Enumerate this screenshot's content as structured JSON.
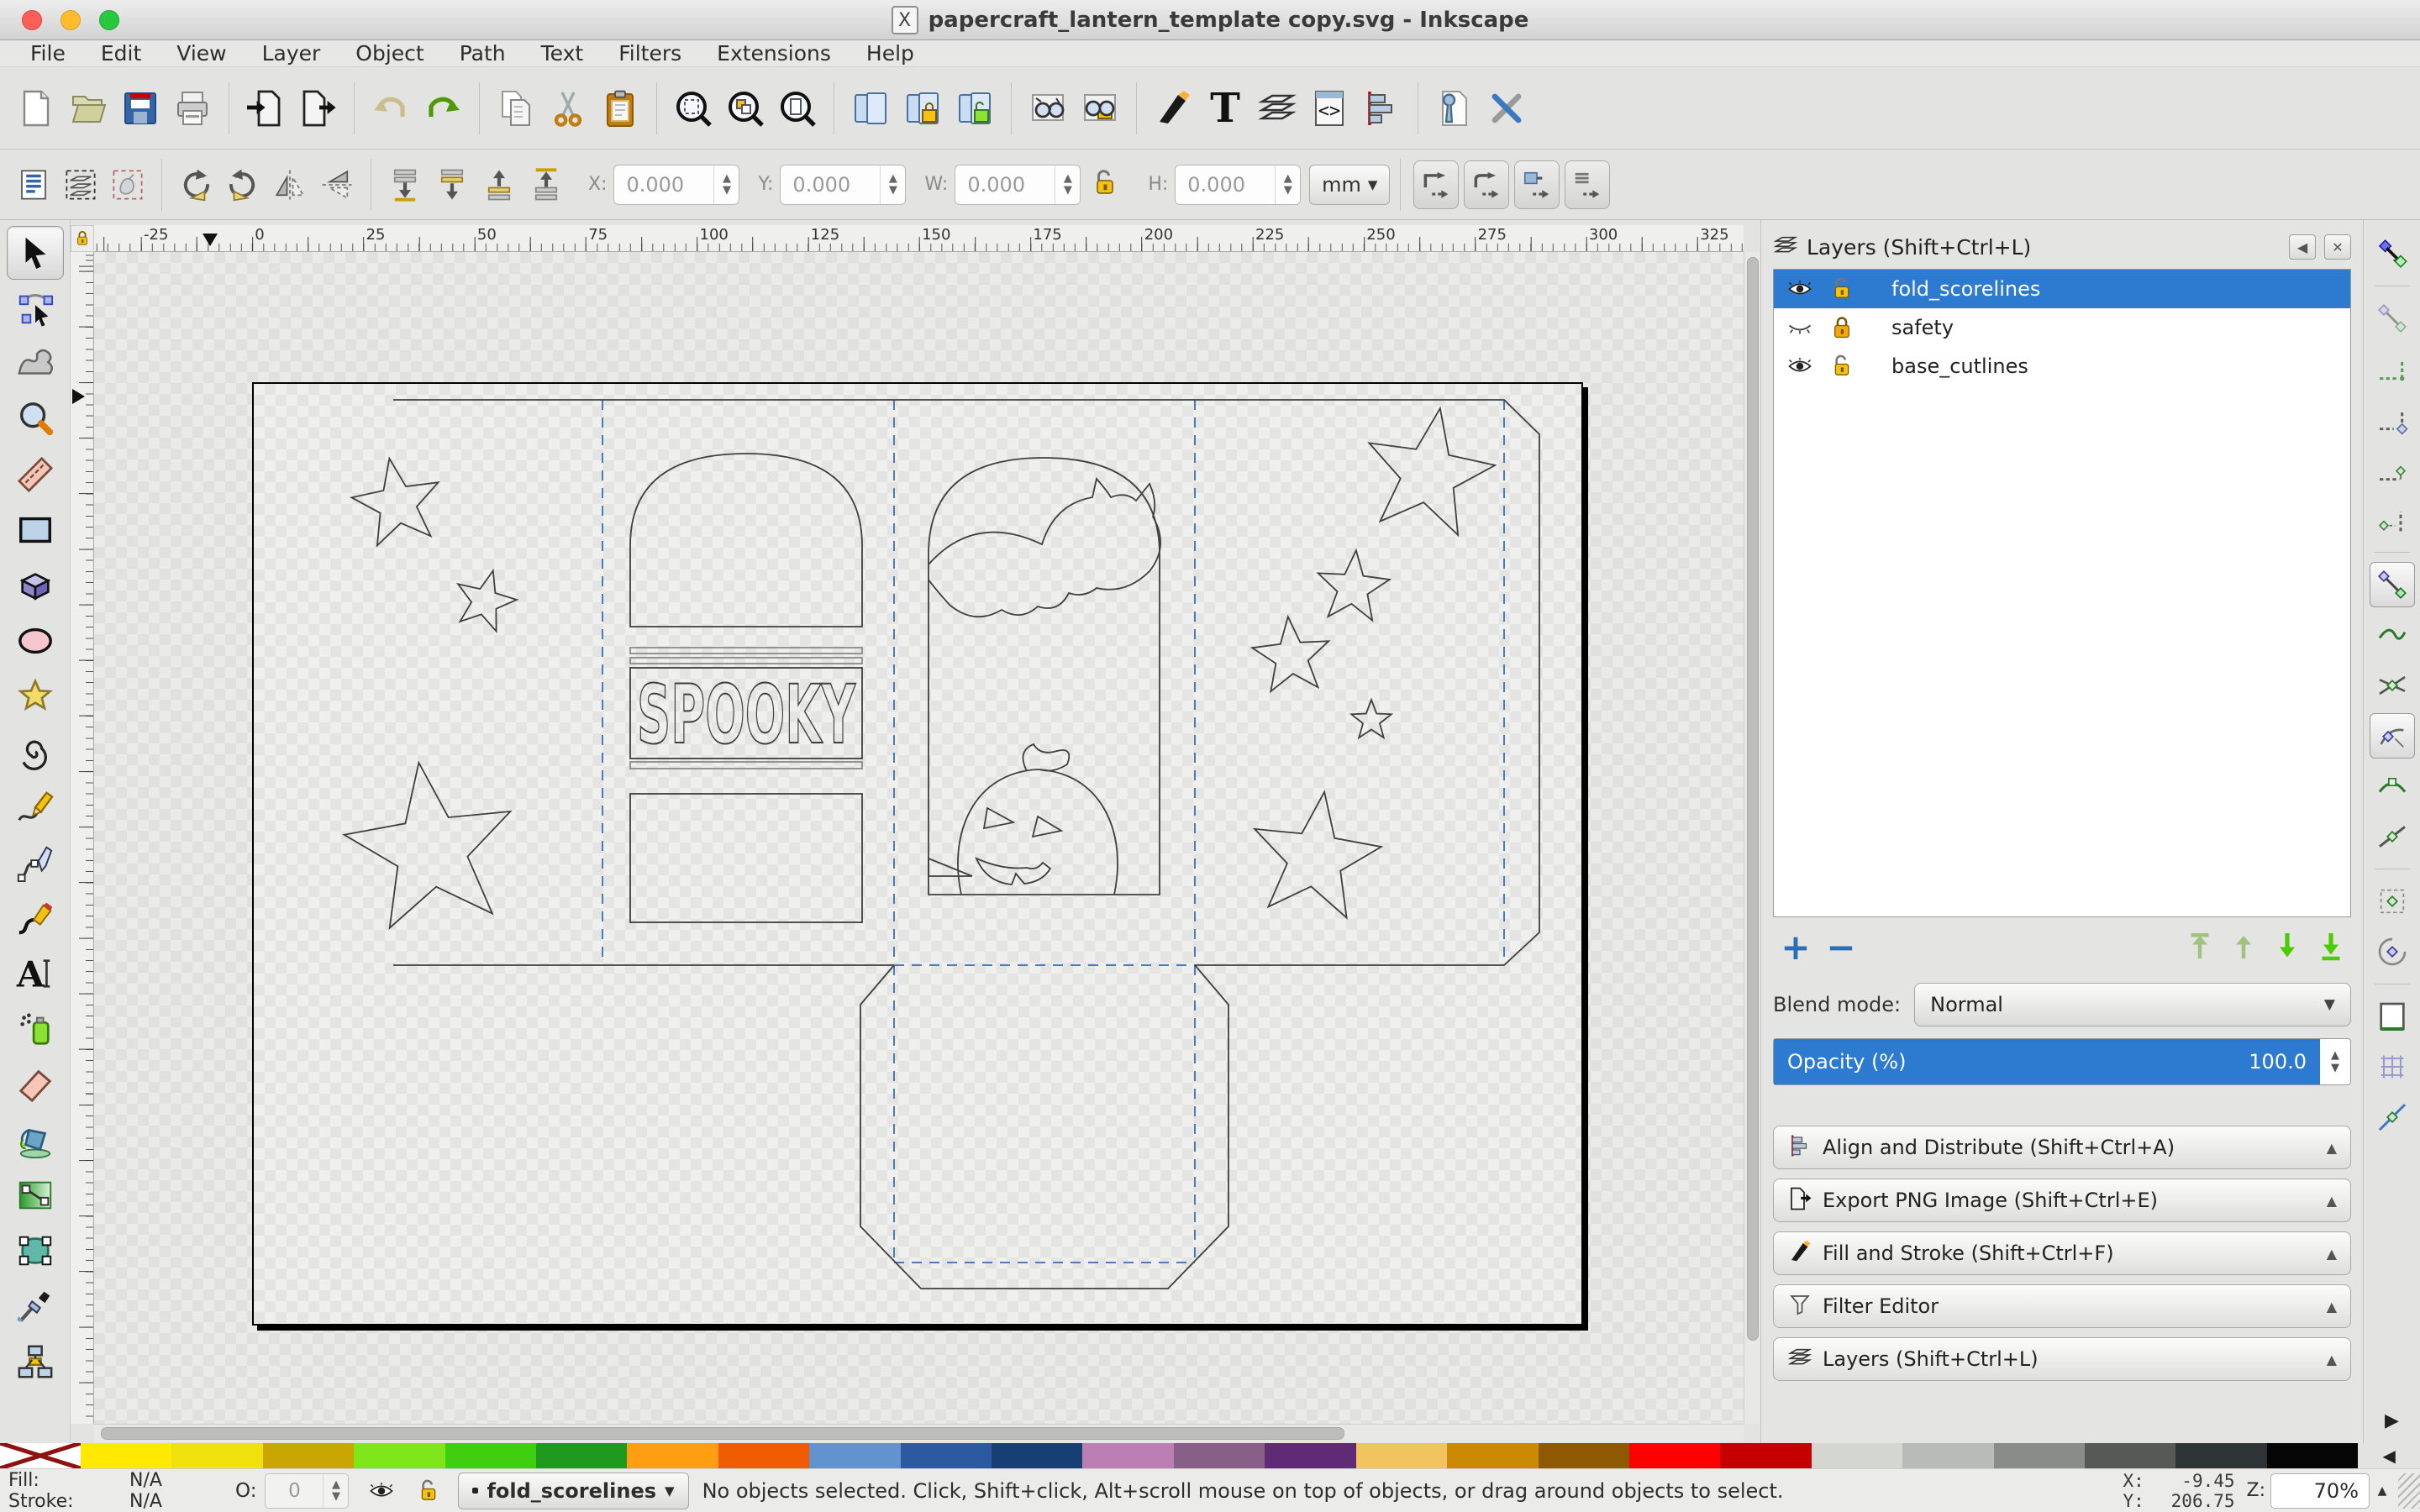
{
  "window": {
    "title": "papercraft_lantern_template copy.svg - Inkscape",
    "app_icon_label": "X"
  },
  "menubar": {
    "items": [
      "File",
      "Edit",
      "View",
      "Layer",
      "Object",
      "Path",
      "Text",
      "Filters",
      "Extensions",
      "Help"
    ]
  },
  "command_toolbar": {
    "groups": [
      [
        "new-document",
        "open-document",
        "save-document",
        "print-document"
      ],
      [
        "import-document",
        "export-document"
      ],
      [
        "undo",
        "redo"
      ],
      [
        "copy",
        "cut",
        "paste"
      ],
      [
        "zoom-selection",
        "zoom-drawing",
        "zoom-page"
      ],
      [
        "duplicate",
        "group",
        "ungroup"
      ],
      [
        "find",
        "find-replace"
      ],
      [
        "fill-stroke-dialog",
        "text-dialog",
        "layers-dialog",
        "xml-editor",
        "align-dialog"
      ],
      [
        "preferences",
        "input-devices"
      ]
    ]
  },
  "tool_options": {
    "icon_groups": [
      [
        "select-all",
        "select-all-layers",
        "deselect"
      ],
      [
        "rotate-ccw",
        "rotate-cw",
        "flip-horizontal",
        "flip-vertical"
      ],
      [
        "lower-to-bottom",
        "lower",
        "raise",
        "raise-to-top"
      ]
    ],
    "fields": {
      "x_label": "X:",
      "x_value": "0.000",
      "y_label": "Y:",
      "y_value": "0.000",
      "w_label": "W:",
      "w_value": "0.000",
      "h_label": "H:",
      "h_value": "0.000",
      "units_value": "mm"
    },
    "toggles": [
      "transform-stroke",
      "transform-corners",
      "transform-gradients",
      "transform-patterns"
    ]
  },
  "tools_palette": {
    "active_tool": "selector",
    "tools": [
      "selector",
      "node-editor",
      "tweak",
      "zoom",
      "measure",
      "rectangle",
      "box-3d",
      "ellipse",
      "star",
      "spiral",
      "pencil",
      "bezier-pen",
      "calligraphy",
      "text",
      "spray",
      "eraser",
      "paint-bucket",
      "gradient",
      "mesh-gradient",
      "dropper",
      "connector"
    ]
  },
  "ruler": {
    "h_labels": [
      "-25",
      "0",
      "25",
      "50",
      "75",
      "100",
      "125",
      "150",
      "175",
      "200",
      "225",
      "250",
      "275",
      "300",
      "325"
    ]
  },
  "layers_panel": {
    "title": "Layers (Shift+Ctrl+L)",
    "rows": [
      {
        "name": "fold_scorelines",
        "visible": true,
        "locked": false,
        "selected": true
      },
      {
        "name": "safety",
        "visible": false,
        "locked": true,
        "selected": false
      },
      {
        "name": "base_cutlines",
        "visible": true,
        "locked": false,
        "selected": false
      }
    ],
    "blend_mode_label": "Blend mode:",
    "blend_mode_value": "Normal",
    "opacity_label": "Opacity (%)",
    "opacity_value": "100.0"
  },
  "dock_panels": [
    {
      "label": "Align and Distribute (Shift+Ctrl+A)",
      "icon": "align-dialog"
    },
    {
      "label": "Export PNG Image (Shift+Ctrl+E)",
      "icon": "export-document"
    },
    {
      "label": "Fill and Stroke (Shift+Ctrl+F)",
      "icon": "fill-stroke-dialog"
    },
    {
      "label": "Filter Editor",
      "icon": "filter-funnel"
    },
    {
      "label": "Layers (Shift+Ctrl+L)",
      "icon": "layers-dialog"
    }
  ],
  "snap_toolbar": {
    "groups": [
      [
        "snap-enable"
      ],
      [
        "snap-bbox",
        "snap-bbox-edges",
        "snap-bbox-corners",
        "snap-bbox-edge-midpoints",
        "snap-bbox-centers"
      ],
      [
        "snap-nodes",
        "snap-paths",
        "snap-path-intersections",
        "snap-cusp-nodes",
        "snap-smooth-nodes",
        "snap-line-midpoints"
      ],
      [
        "snap-object-centers",
        "snap-rotation-centers"
      ],
      [
        "snap-page-border",
        "snap-grids",
        "snap-guides"
      ]
    ],
    "pressed": [
      "snap-nodes",
      "snap-cusp-nodes"
    ]
  },
  "palette": {
    "swatches": [
      "#ffe900",
      "#f0e10c",
      "#c9a602",
      "#7fe61c",
      "#3fcf10",
      "#1f9a1f",
      "#ff9e12",
      "#ef5c00",
      "#6193cf",
      "#2c5aa0",
      "#173f73",
      "#bb7fb4",
      "#875f87",
      "#5f2b76",
      "#f2c45f",
      "#cc8a04",
      "#8f5902",
      "#ff0000",
      "#c40000",
      "#d3d7cf",
      "#b9bcb6",
      "#8a8c87",
      "#565955",
      "#2e3436",
      "#060606"
    ]
  },
  "statusbar": {
    "fill_label": "Fill:",
    "fill_value": "N/A",
    "stroke_label": "Stroke:",
    "stroke_value": "N/A",
    "opacity_label": "O:",
    "opacity_value": "0",
    "layer_indicator": "fold_scorelines",
    "message": "No objects selected. Click, Shift+click, Alt+scroll mouse on top of objects, or drag around objects to select.",
    "x_label": "X:",
    "x_value": "-9.45",
    "y_label": "Y:",
    "y_value": "206.75",
    "zoom_label": "Z:",
    "zoom_value": "70%"
  },
  "canvas": {
    "spooky_text": "SPOOKY"
  }
}
